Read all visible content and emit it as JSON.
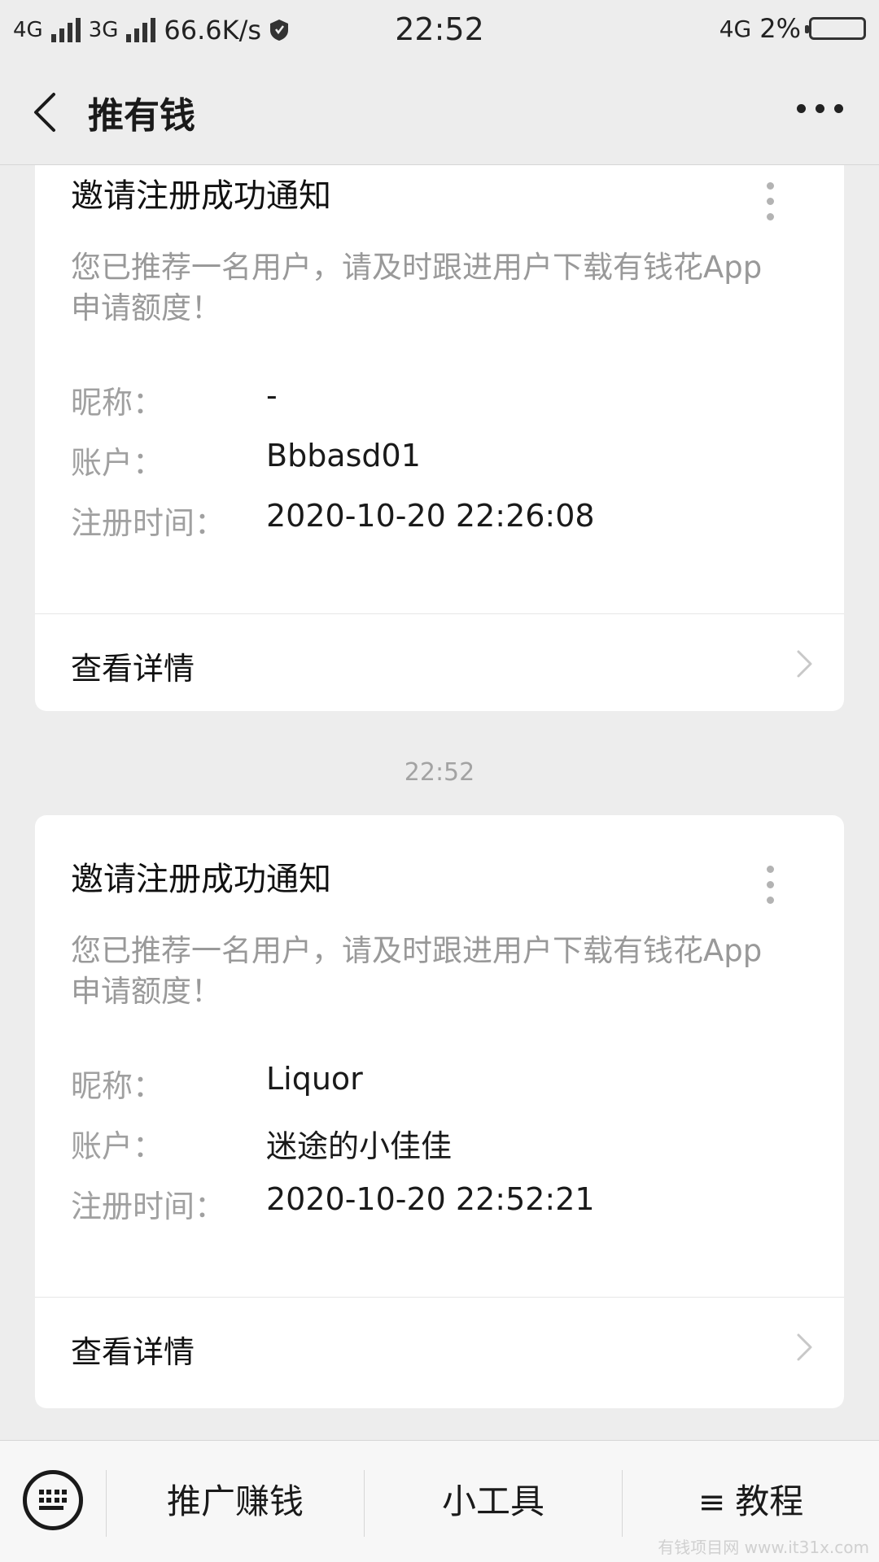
{
  "status_bar": {
    "net1": "4G",
    "net2": "3G",
    "speed": "66.6K/s",
    "time": "22:52",
    "net_right": "4G",
    "battery_percent": "2%",
    "battery_level": 0.02
  },
  "header": {
    "title": "推有钱"
  },
  "feed": {
    "time_stamp": "22:52",
    "cards": [
      {
        "title": "邀请注册成功通知",
        "description": "您已推荐一名用户，请及时跟进用户下载有钱花App申请额度！",
        "fields": [
          {
            "label": "昵称：",
            "value": "-"
          },
          {
            "label": "账户：",
            "value": "Bbbasd01"
          },
          {
            "label": "注册时间：",
            "value": "2020-10-20 22:26:08"
          }
        ],
        "detail_label": "查看详情"
      },
      {
        "title": "邀请注册成功通知",
        "description": "您已推荐一名用户，请及时跟进用户下载有钱花App申请额度！",
        "fields": [
          {
            "label": "昵称：",
            "value": "Liquor"
          },
          {
            "label": "账户：",
            "value": "迷途的小佳佳"
          },
          {
            "label": "注册时间：",
            "value": "2020-10-20 22:52:21"
          }
        ],
        "detail_label": "查看详情"
      }
    ]
  },
  "bottom_menu": {
    "items": [
      {
        "label": "推广赚钱"
      },
      {
        "label": "小工具"
      },
      {
        "label": "教程",
        "prefix": "≡"
      }
    ]
  },
  "watermark": "有钱项目网 www.it31x.com"
}
